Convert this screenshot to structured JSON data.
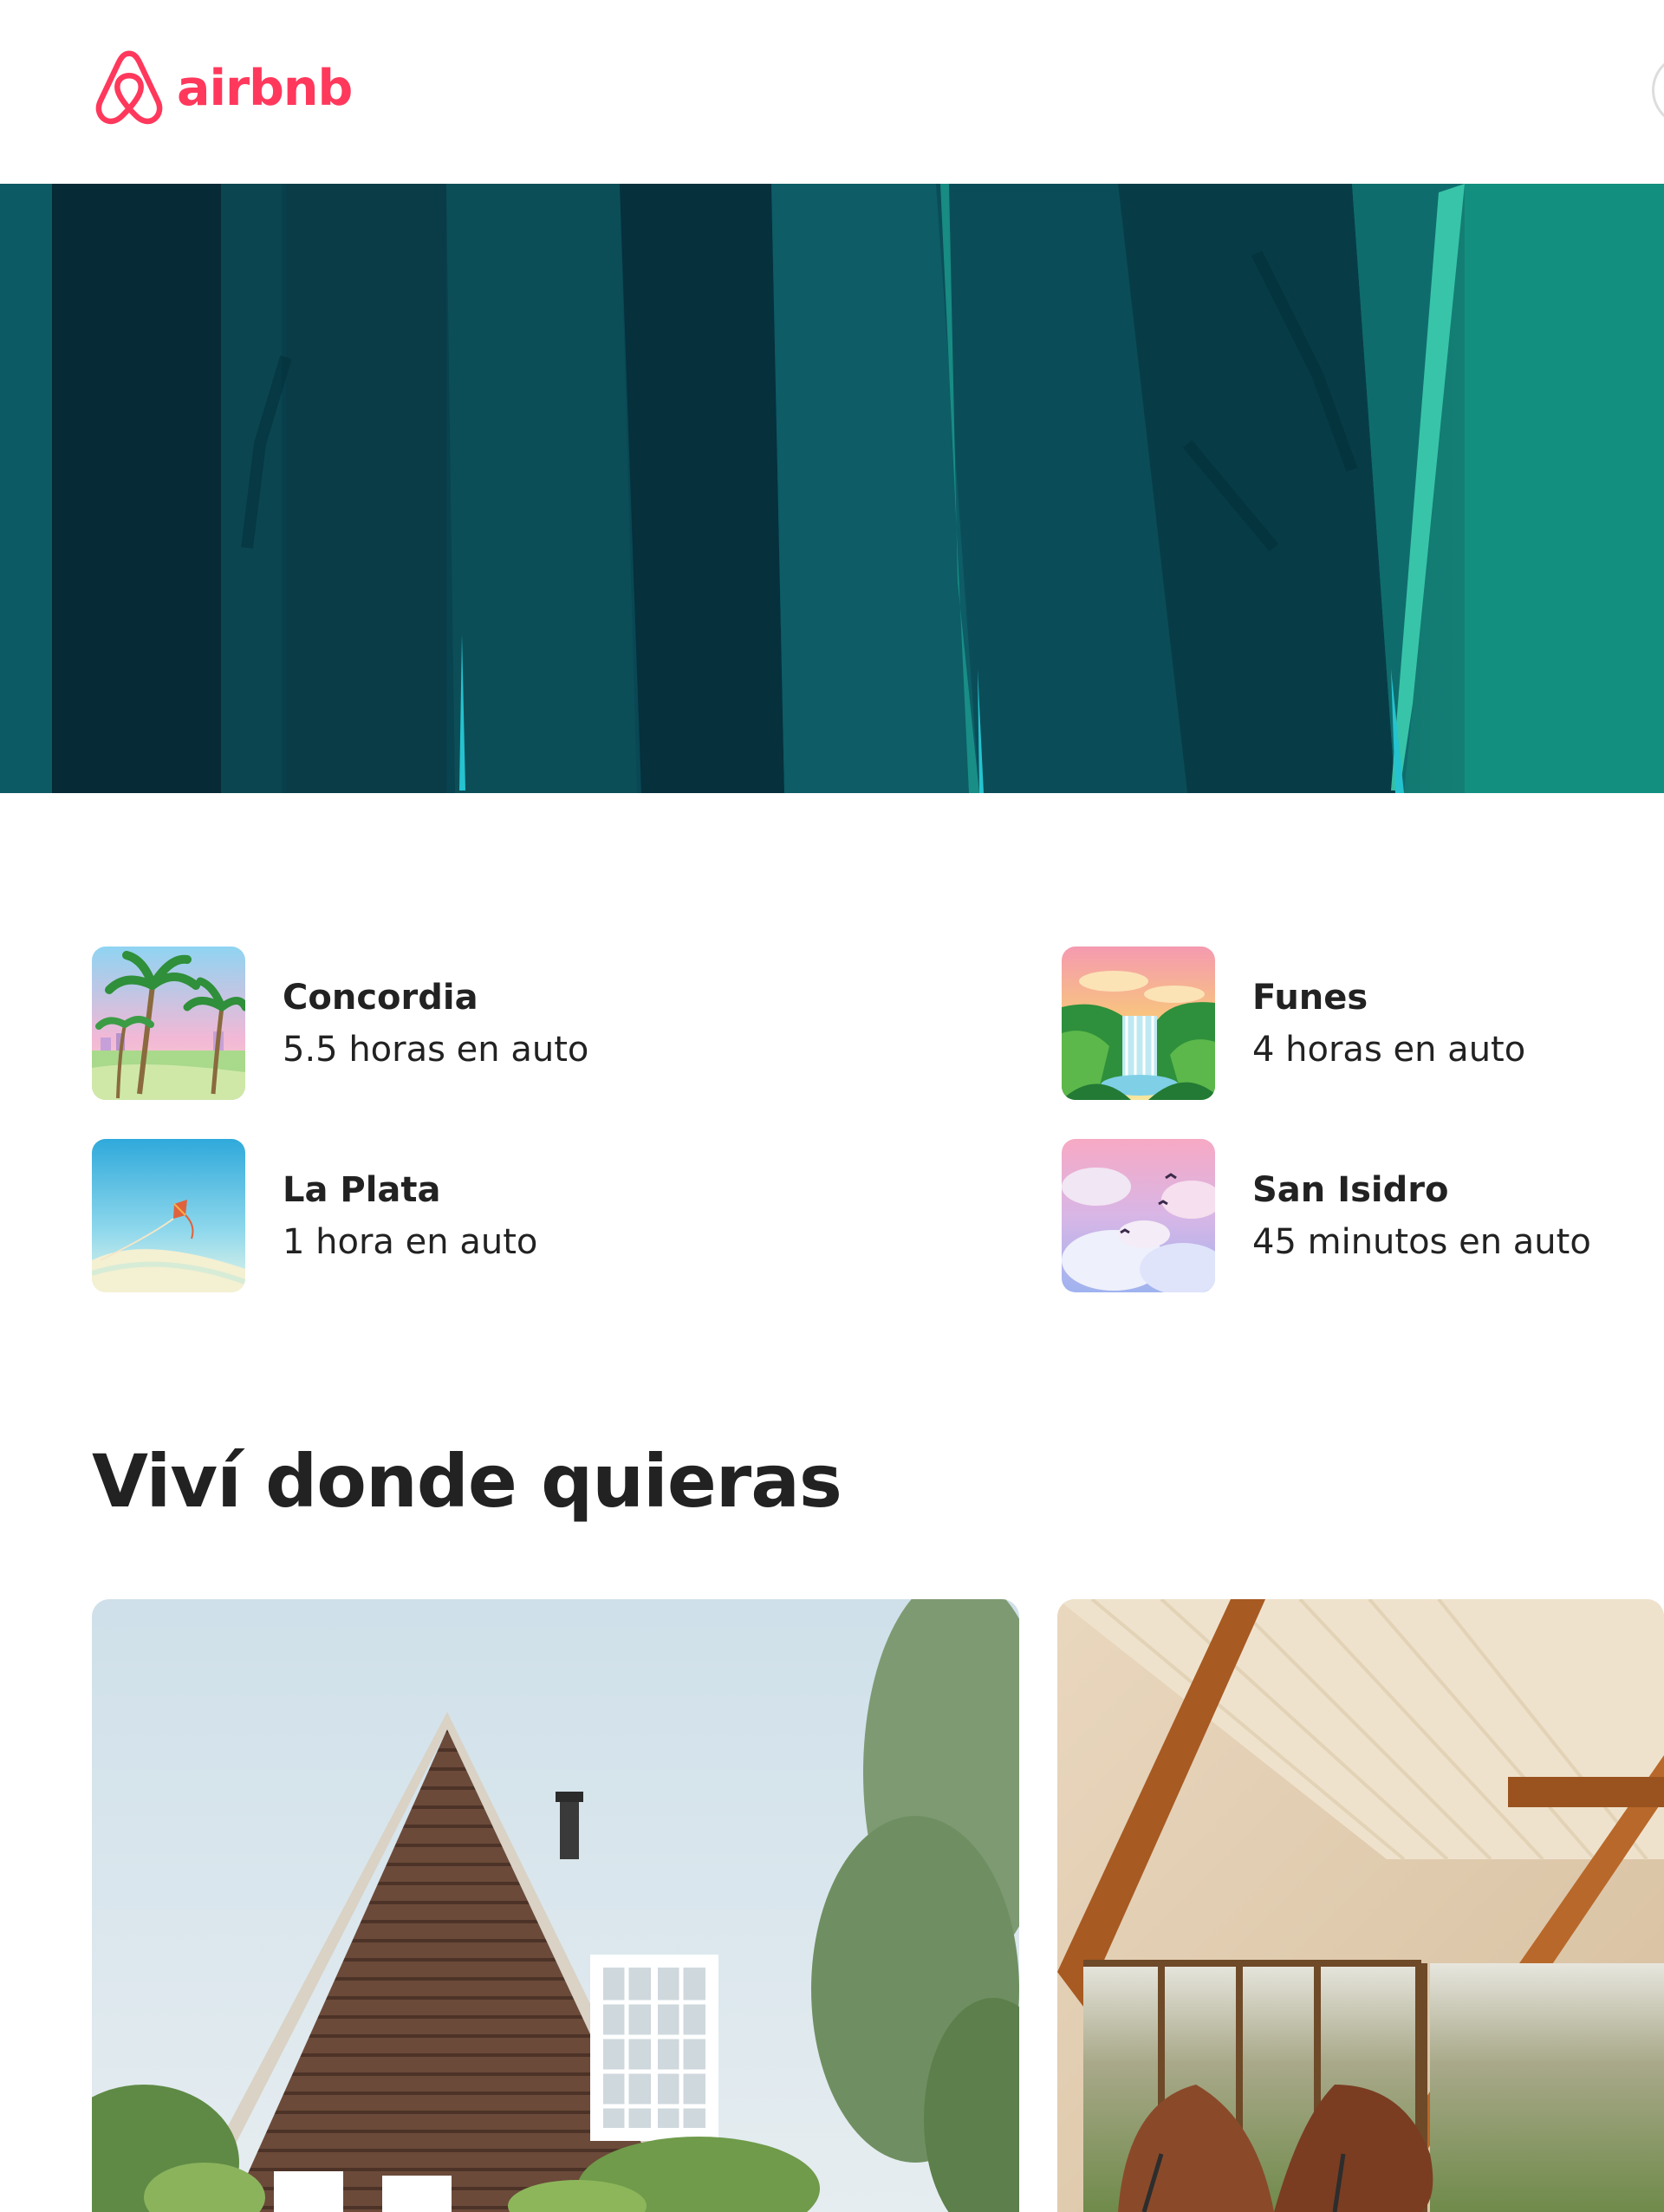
{
  "brand": {
    "name": "airbnb",
    "color": "#FF385C"
  },
  "destinations": [
    {
      "name": "Concordia",
      "time": "5.5 horas en auto",
      "thumb": "palm-trees-illustration"
    },
    {
      "name": "Funes",
      "time": "4 horas en auto",
      "thumb": "waterfall-illustration"
    },
    {
      "name": "La Plata",
      "time": "1 hora en auto",
      "thumb": "kite-illustration"
    },
    {
      "name": "San Isidro",
      "time": "45 minutos en auto",
      "thumb": "clouds-birds-illustration"
    }
  ],
  "section": {
    "title": "Viví donde quieras"
  },
  "cards": [
    {
      "image": "wooden-house-photo"
    },
    {
      "image": "a-frame-interior-photo"
    }
  ]
}
